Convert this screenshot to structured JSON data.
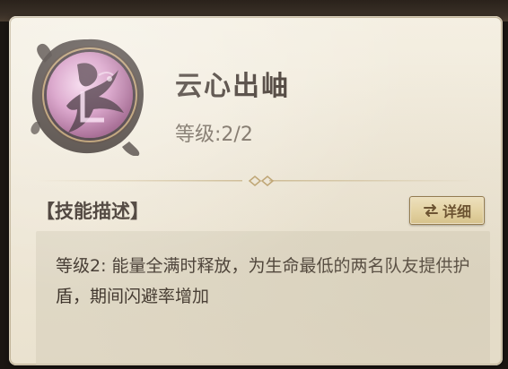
{
  "skill": {
    "name": "云心出岫",
    "level_text": "等级:2/2",
    "icon": "skill-portrait-icon"
  },
  "description": {
    "heading": "【技能描述】",
    "detail_button": {
      "icon": "swap-arrows-icon",
      "label": "详细"
    },
    "text": "等级2: 能量全满时释放，为生命最低的两名队友提供护盾，期间闪避率增加"
  },
  "colors": {
    "panel_bg": "#f1ebdd",
    "title_text": "#3a2f27",
    "button_bg": "#e9d7a3",
    "icon_glow": "#cf89bb"
  }
}
